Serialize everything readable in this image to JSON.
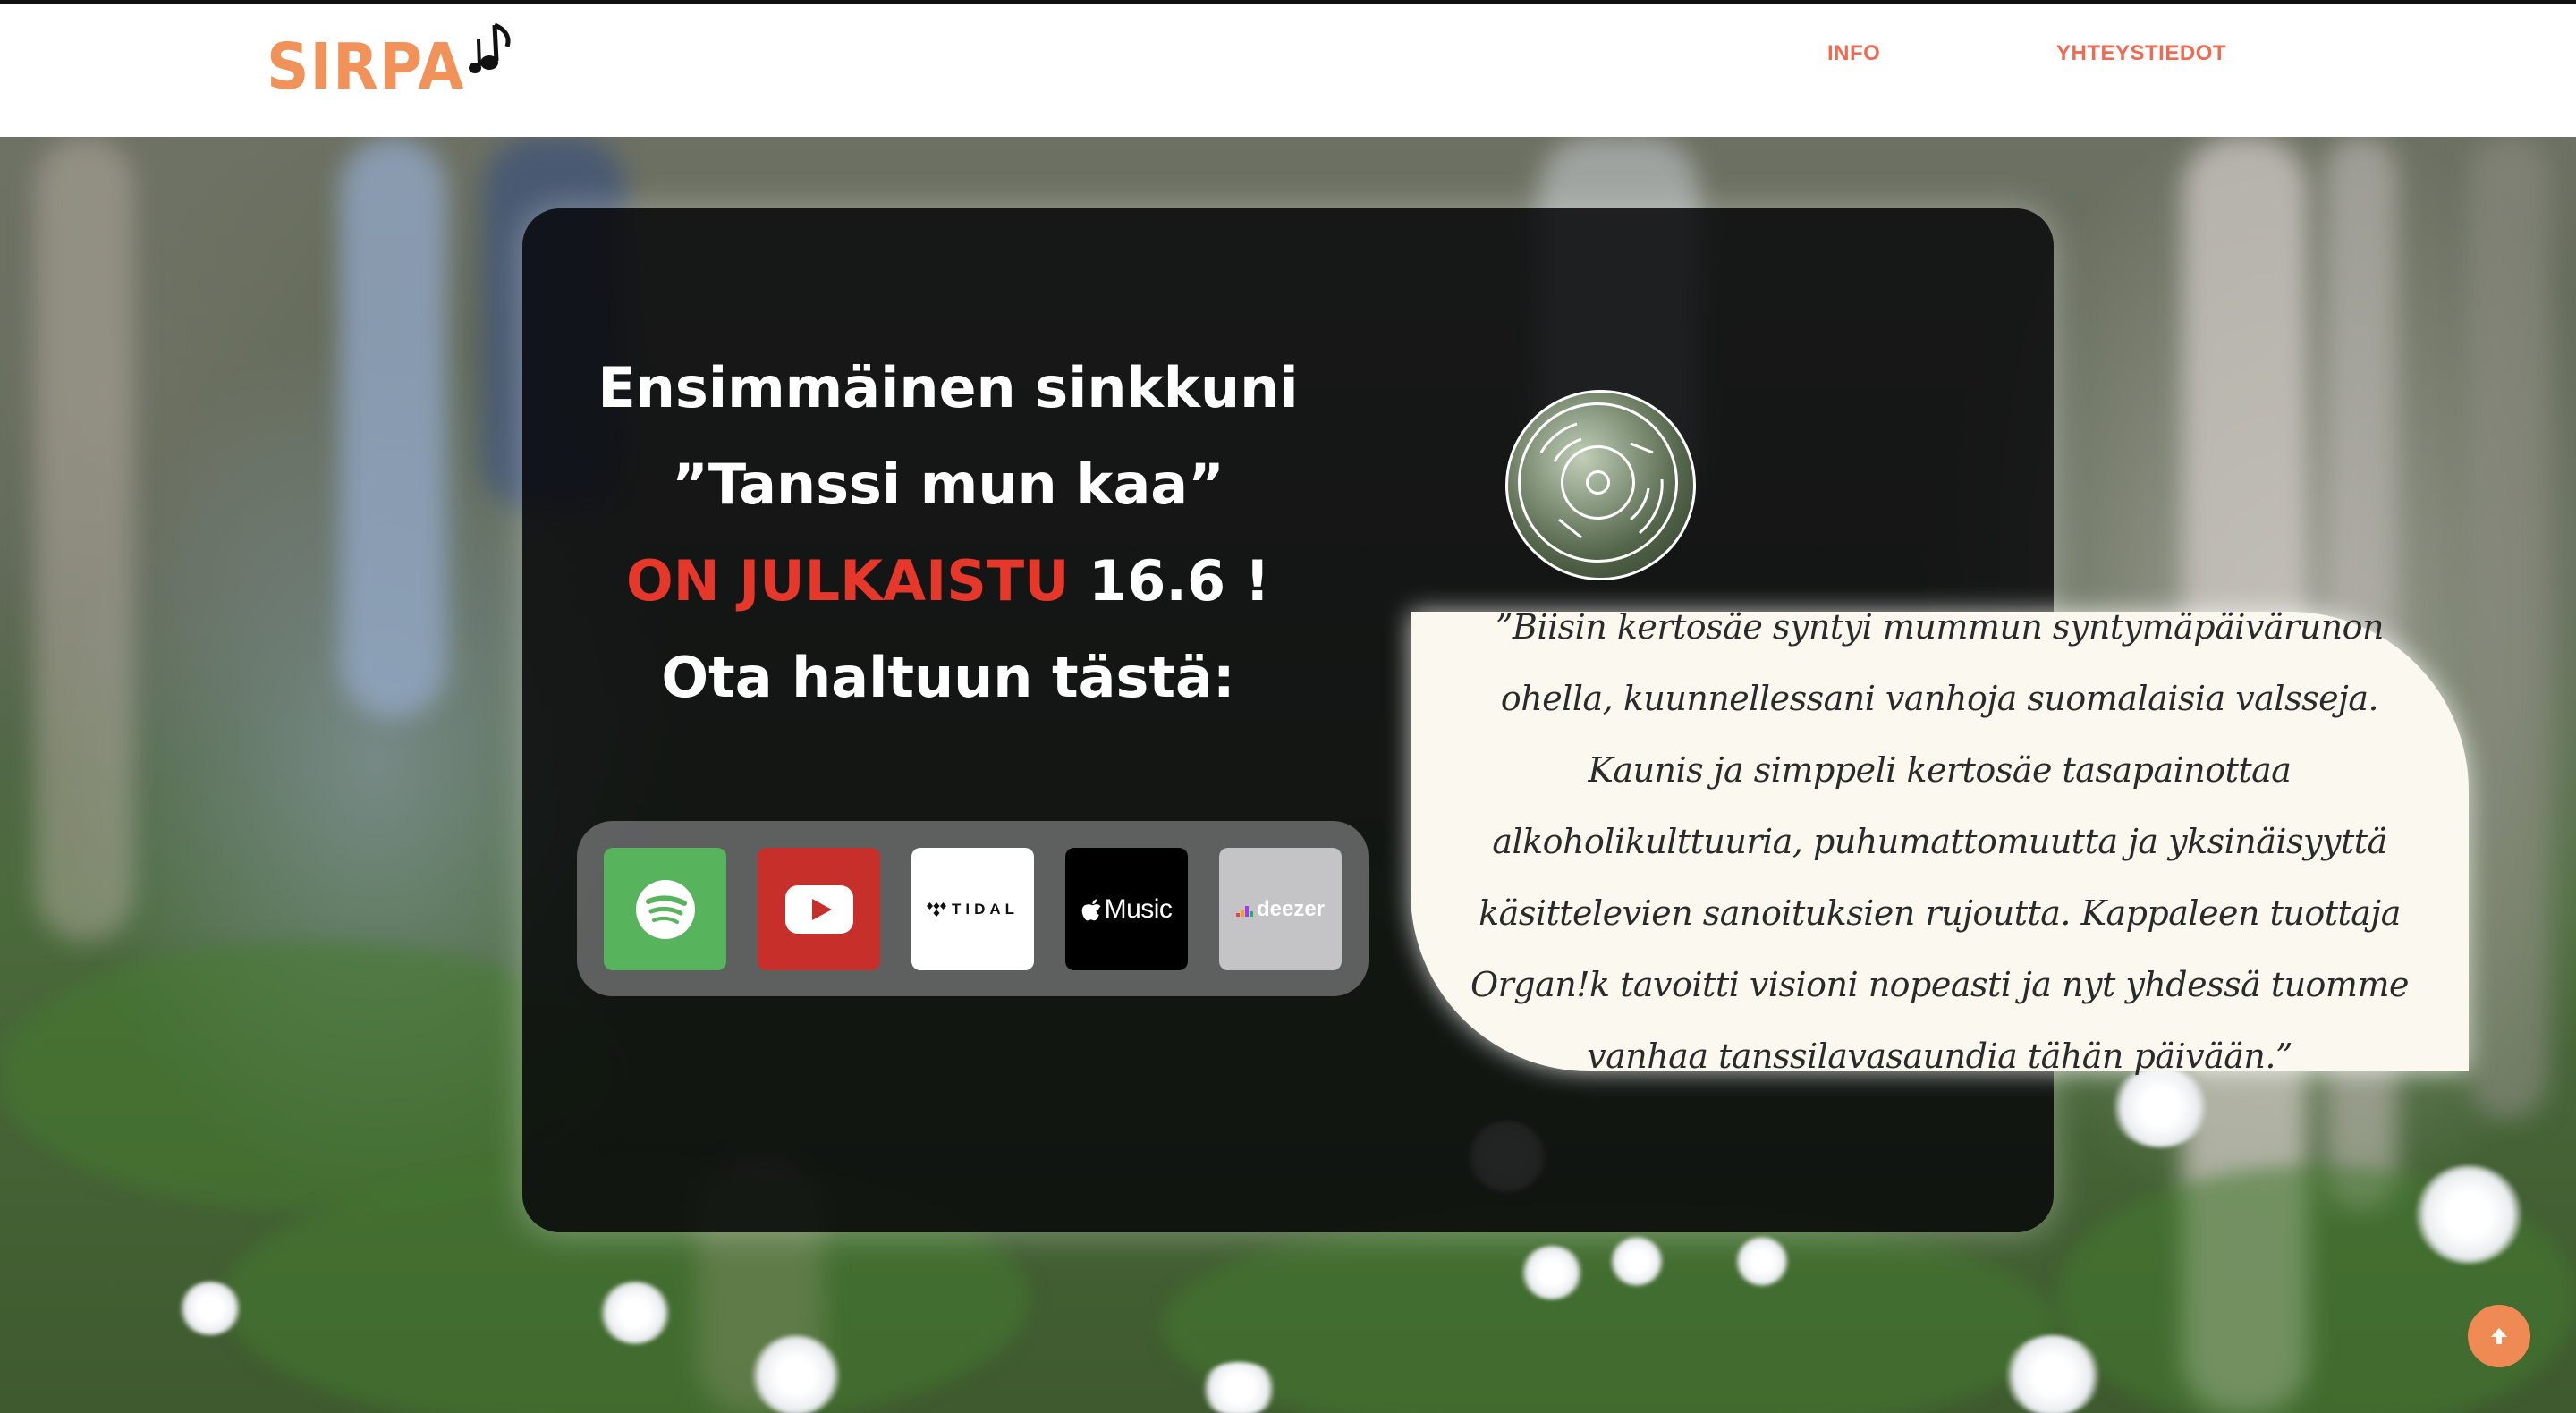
{
  "brand": {
    "name": "SIRPA",
    "accent_color": "#f0925a",
    "icon": "music-note-icon"
  },
  "nav": {
    "info": "INFO",
    "contact": "YHTEYSTIEDOT",
    "link_color": "#ef6a52"
  },
  "hero": {
    "line1": "Ensimmäinen sinkkuni",
    "line2": "”Tanssi mun kaa”",
    "line3_highlight": "ON JULKAISTU",
    "line3_rest": " 16.6 !",
    "line4": "Ota haltuun tästä:",
    "highlight_color": "#e5382a"
  },
  "streaming": [
    {
      "service": "Spotify",
      "icon": "spotify-icon",
      "color": "#57b35c"
    },
    {
      "service": "YouTube",
      "icon": "youtube-icon",
      "color": "#c62f2a"
    },
    {
      "service": "TIDAL",
      "label": "TIDAL",
      "icon": "tidal-icon",
      "color": "#ffffff"
    },
    {
      "service": "Apple Music",
      "label": "Music",
      "icon": "apple-icon",
      "color": "#000000"
    },
    {
      "service": "Deezer",
      "label": "deezer",
      "icon": "deezer-icon",
      "color": "#c4c4c6"
    }
  ],
  "quote": {
    "text": "”Biisin kertosäe syntyi mummun syntymäpäivärunon ohella, kuunnellessani vanhoja suomalaisia valsseja. Kaunis ja simppeli kertosäe tasapainottaa alkoholikulttuuria, puhumattomuutta ja yksinäisyyttä käsittelevien sanoituksien rujoutta. Kappaleen tuottaja Organ!k tavoitti visioni nopeasti ja nyt yhdessä tuomme vanhaa tanssilavasaundia tähän päivään.”"
  },
  "scroll_top": {
    "icon": "arrow-up-icon",
    "color": "#ef8a55"
  }
}
